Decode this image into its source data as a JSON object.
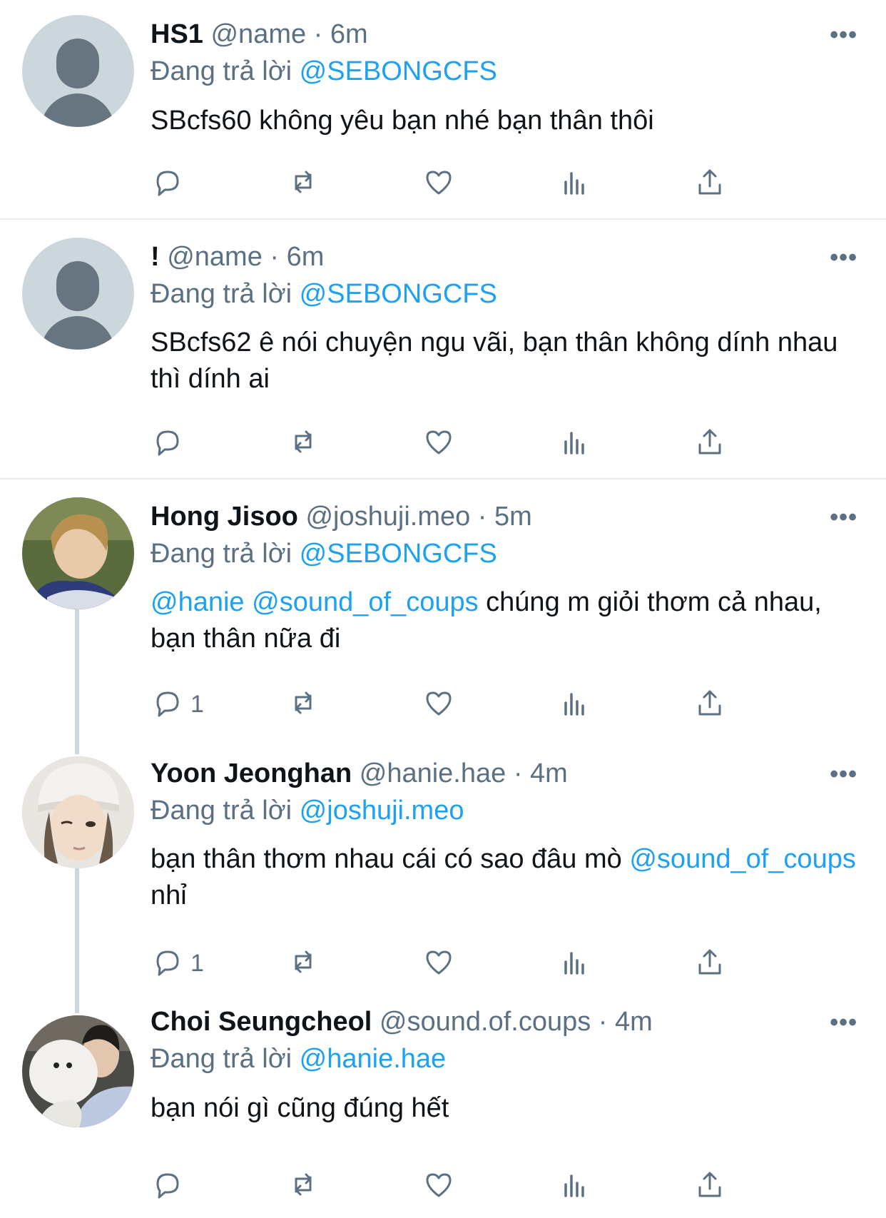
{
  "tweets": [
    {
      "display_name": "HS1",
      "meta": "@name · 6m",
      "reply_prefix": "Đang trả lời ",
      "reply_to": "@SEBONGCFS",
      "text_parts": [
        "SBcfs60 không yêu bạn nhé bạn thân thôi"
      ],
      "reply_count": ""
    },
    {
      "display_name": "!",
      "meta": "@name · 6m",
      "reply_prefix": "Đang trả lời ",
      "reply_to": "@SEBONGCFS",
      "text_parts": [
        "SBcfs62 ê nói chuyện ngu vãi, bạn thân không dính nhau thì dính ai"
      ],
      "reply_count": ""
    },
    {
      "display_name": "Hong Jisoo",
      "meta": "@joshuji.meo · 5m",
      "reply_prefix": "Đang trả lời ",
      "reply_to": "@SEBONGCFS",
      "mention1": "@hanie",
      "mention2": "@sound_of_coups",
      "text_rest": " chúng m giỏi thơm cả nhau, bạn thân nữa đi",
      "reply_count": "1"
    },
    {
      "display_name": "Yoon Jeonghan",
      "meta": "@hanie.hae · 4m",
      "reply_prefix": "Đang trả lời ",
      "reply_to": "@joshuji.meo",
      "text_start": "bạn thân thơm nhau cái có sao đâu mò ",
      "mention": "@sound_of_coups",
      "text_end": " nhỉ",
      "reply_count": "1"
    },
    {
      "display_name": "Choi Seungcheol",
      "meta": "@sound.of.coups · 4m",
      "reply_prefix": "Đang trả lời ",
      "reply_to": "@hanie.hae",
      "text_parts": [
        "bạn nói gì cũng đúng hết"
      ],
      "reply_count": ""
    }
  ],
  "more_label": "•••",
  "icons": [
    "reply-icon",
    "retweet-icon",
    "like-icon",
    "analytics-icon",
    "share-icon"
  ],
  "colors": {
    "link": "#1da1f2",
    "muted": "#5b7083",
    "text": "#0f1419",
    "separator": "#e6ecf0"
  }
}
